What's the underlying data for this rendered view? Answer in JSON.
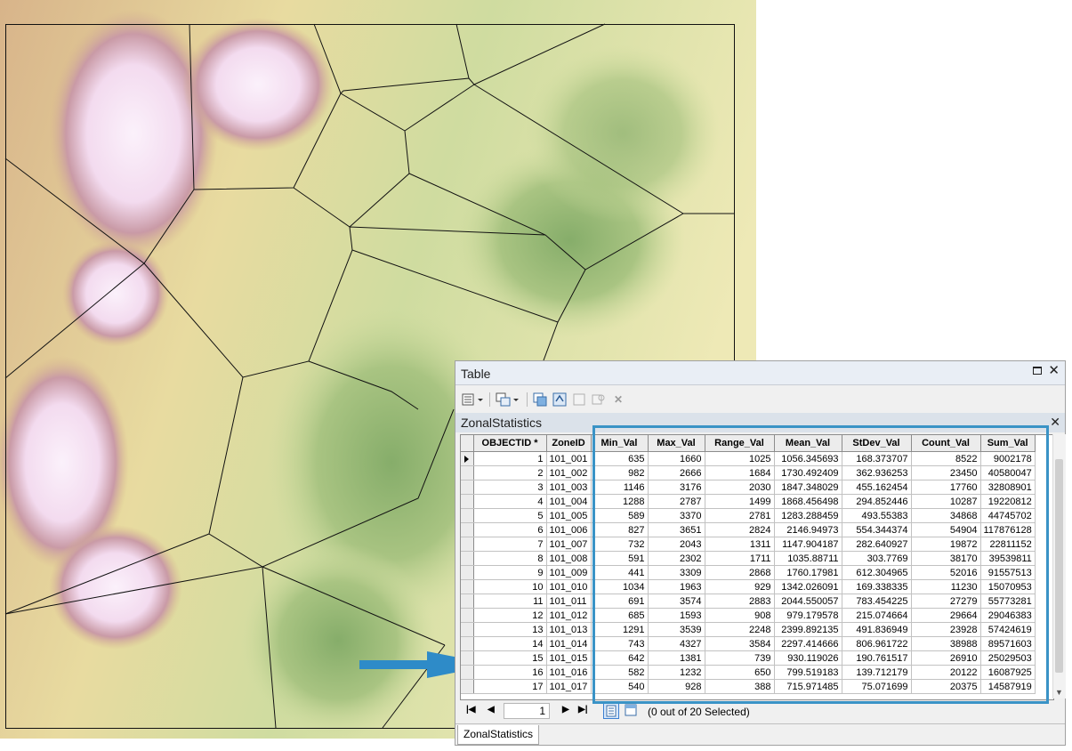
{
  "window": {
    "title": "Table"
  },
  "toolbar": {
    "icons": [
      "table-options-icon",
      "related-tables-icon",
      "select-by-attributes-icon",
      "switch-selection-icon",
      "clear-selection-icon",
      "zoom-to-selected-icon",
      "delete-selected-icon"
    ]
  },
  "table_name": "ZonalStatistics",
  "columns": [
    "OBJECTID *",
    "ZoneID",
    "Min_Val",
    "Max_Val",
    "Range_Val",
    "Mean_Val",
    "StDev_Val",
    "Count_Val",
    "Sum_Val"
  ],
  "rows": [
    [
      "1",
      "101_001",
      "635",
      "1660",
      "1025",
      "1056.345693",
      "168.373707",
      "8522",
      "9002178"
    ],
    [
      "2",
      "101_002",
      "982",
      "2666",
      "1684",
      "1730.492409",
      "362.936253",
      "23450",
      "40580047"
    ],
    [
      "3",
      "101_003",
      "1146",
      "3176",
      "2030",
      "1847.348029",
      "455.162454",
      "17760",
      "32808901"
    ],
    [
      "4",
      "101_004",
      "1288",
      "2787",
      "1499",
      "1868.456498",
      "294.852446",
      "10287",
      "19220812"
    ],
    [
      "5",
      "101_005",
      "589",
      "3370",
      "2781",
      "1283.288459",
      "493.55383",
      "34868",
      "44745702"
    ],
    [
      "6",
      "101_006",
      "827",
      "3651",
      "2824",
      "2146.94973",
      "554.344374",
      "54904",
      "117876128"
    ],
    [
      "7",
      "101_007",
      "732",
      "2043",
      "1311",
      "1147.904187",
      "282.640927",
      "19872",
      "22811152"
    ],
    [
      "8",
      "101_008",
      "591",
      "2302",
      "1711",
      "1035.88711",
      "303.7769",
      "38170",
      "39539811"
    ],
    [
      "9",
      "101_009",
      "441",
      "3309",
      "2868",
      "1760.17981",
      "612.304965",
      "52016",
      "91557513"
    ],
    [
      "10",
      "101_010",
      "1034",
      "1963",
      "929",
      "1342.026091",
      "169.338335",
      "11230",
      "15070953"
    ],
    [
      "11",
      "101_011",
      "691",
      "3574",
      "2883",
      "2044.550057",
      "783.454225",
      "27279",
      "55773281"
    ],
    [
      "12",
      "101_012",
      "685",
      "1593",
      "908",
      "979.179578",
      "215.074664",
      "29664",
      "29046383"
    ],
    [
      "13",
      "101_013",
      "1291",
      "3539",
      "2248",
      "2399.892135",
      "491.836949",
      "23928",
      "57424619"
    ],
    [
      "14",
      "101_014",
      "743",
      "4327",
      "3584",
      "2297.414666",
      "806.961722",
      "38988",
      "89571603"
    ],
    [
      "15",
      "101_015",
      "642",
      "1381",
      "739",
      "930.119026",
      "190.761517",
      "26910",
      "25029503"
    ],
    [
      "16",
      "101_016",
      "582",
      "1232",
      "650",
      "799.519183",
      "139.712179",
      "20122",
      "16087925"
    ],
    [
      "17",
      "101_017",
      "540",
      "928",
      "388",
      "715.971485",
      "75.071699",
      "20375",
      "14587919"
    ]
  ],
  "navigation": {
    "current_record": "1",
    "selection_status": "(0 out of 20 Selected)"
  },
  "tabs": [
    "ZonalStatistics"
  ],
  "colors": {
    "highlight": "#3a93c6",
    "arrow": "#2e8bc8"
  }
}
